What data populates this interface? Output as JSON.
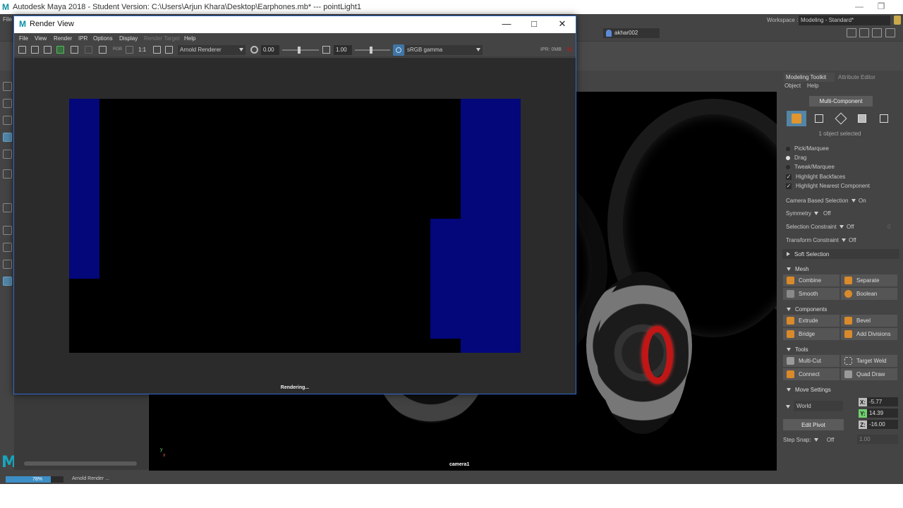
{
  "maya": {
    "title": "Autodesk Maya 2018 - Student Version: C:\\Users\\Arjun Khara\\Desktop\\Earphones.mb*   ---   pointLight1",
    "file_menu": "File",
    "workspace_label": "Workspace :",
    "workspace_value": "Modeling - Standard*",
    "user": "akhar002"
  },
  "render_view": {
    "title": "Render View",
    "menus": [
      "File",
      "View",
      "Render",
      "IPR",
      "Options",
      "Display",
      "Render Target",
      "Help"
    ],
    "rgb_label": "RGB",
    "one_to_one": "1:1",
    "renderer": "Arnold Renderer",
    "exposure": "0.00",
    "gamma": "1.00",
    "colorspace": "sRGB gamma",
    "ipr_memory": "IPR: 0MB",
    "status": "Rendering..."
  },
  "viewport": {
    "camera": "camera1",
    "axis_y": "y",
    "axis_x": "x"
  },
  "toolkit": {
    "tab_active": "Modeling Toolkit",
    "tab_other": "Attribute Editor",
    "menu_object": "Object",
    "menu_help": "Help",
    "mode_button": "Multi-Component",
    "selection_count": "1 object selected",
    "pick_marquee": "Pick/Marquee",
    "drag": "Drag",
    "tweak_marquee": "Tweak/Marquee",
    "highlight_backfaces": "Highlight Backfaces",
    "highlight_nearest": "Highlight Nearest Component",
    "camera_based_selection_label": "Camera Based Selection",
    "camera_based_selection_value": "On",
    "symmetry_label": "Symmetry",
    "symmetry_value": "Off",
    "selection_constraint_label": "Selection Constraint",
    "selection_constraint_value": "Off",
    "selection_constraint_num": "0",
    "transform_constraint_label": "Transform Constraint",
    "transform_constraint_value": "Off",
    "soft_selection": "Soft Selection",
    "mesh_header": "Mesh",
    "combine": "Combine",
    "separate": "Separate",
    "smooth": "Smooth",
    "boolean": "Boolean",
    "components_header": "Components",
    "extrude": "Extrude",
    "bevel": "Bevel",
    "bridge": "Bridge",
    "add_divisions": "Add Divisions",
    "tools_header": "Tools",
    "multi_cut": "Multi-Cut",
    "target_weld": "Target Weld",
    "connect": "Connect",
    "quad_draw": "Quad Draw",
    "move_settings_header": "Move Settings",
    "world": "World",
    "x_label": "X:",
    "x_value": "-5.77",
    "y_label": "Y:",
    "y_value": "14.39",
    "z_label": "Z:",
    "z_value": "-16.00",
    "edit_pivot": "Edit Pivot",
    "step_snap_label": "Step Snap:",
    "step_snap_value": "Off",
    "step_snap_num": "1.00"
  },
  "status_bar": {
    "progress_text": "78%",
    "progress_fraction": 0.78,
    "message": "Arnold Render ..."
  },
  "colors": {
    "render_tile_blue": "#03077a",
    "accent_blue": "#5285a6",
    "headphone_ring_red": "#c01616"
  }
}
